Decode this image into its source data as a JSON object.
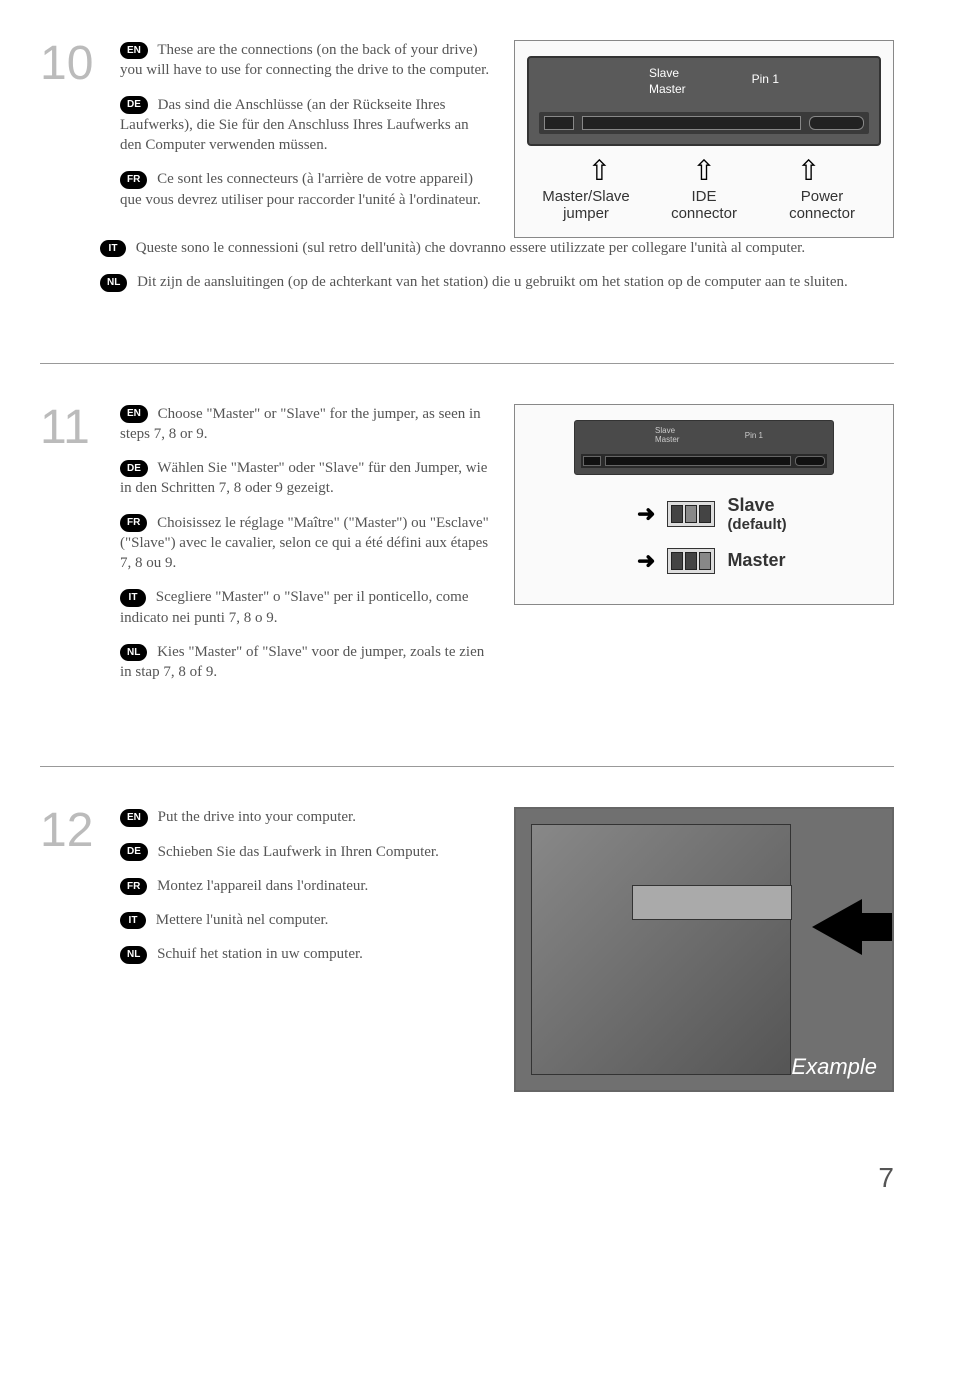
{
  "page_number": "7",
  "steps": {
    "s10": {
      "number": "10",
      "en": "These are the connections (on the back of your drive) you will have to use for connecting the drive to the computer.",
      "de": "Das sind die Anschlüsse (an der Rückseite Ihres Laufwerks), die Sie für den Anschluss Ihres Laufwerks an den Computer verwenden müssen.",
      "fr": "Ce sont les connecteurs (à l'arrière de votre appareil) que vous devrez utiliser pour raccorder l'unité à l'ordinateur.",
      "it": "Queste sono le connessioni (sul retro dell'unità) che dovranno essere utilizzate per collegare l'unità al computer.",
      "nl": "Dit zijn de aansluitingen (op de achterkant van het station) die u gebruikt om het station op de computer aan te sluiten."
    },
    "s11": {
      "number": "11",
      "en": "Choose \"Master\" or \"Slave\" for the jumper, as seen in steps 7, 8 or 9.",
      "de": "Wählen Sie \"Master\" oder \"Slave\" für den Jumper, wie in den Schritten 7, 8 oder 9 gezeigt.",
      "fr": "Choisissez le réglage \"Maître\" (\"Master\") ou \"Esclave\" (\"Slave\") avec le cavalier, selon ce qui a été défini aux étapes 7, 8 ou 9.",
      "it": "Scegliere \"Master\" o \"Slave\" per il ponticello, come indicato nei punti 7, 8 o 9.",
      "nl": "Kies \"Master\" of \"Slave\" voor de jumper, zoals te zien in stap 7, 8 of 9."
    },
    "s12": {
      "number": "12",
      "en": "Put the drive into your computer.",
      "de": "Schieben Sie das Laufwerk in Ihren Computer.",
      "fr": "Montez l'appareil dans l'ordinateur.",
      "it": "Mettere l'unità nel computer.",
      "nl": "Schuif het station in uw computer."
    }
  },
  "badges": {
    "en": "EN",
    "de": "DE",
    "fr": "FR",
    "it": "IT",
    "nl": "NL"
  },
  "diagram10": {
    "slave": "Slave",
    "master": "Master",
    "pin1": "Pin 1",
    "label1_line1": "Master/Slave",
    "label1_line2": "jumper",
    "label2_line1": "IDE",
    "label2_line2": "connector",
    "label3_line1": "Power",
    "label3_line2": "connector"
  },
  "diagram11": {
    "mini_slave": "Slave",
    "mini_master": "Master",
    "mini_pin": "Pin 1",
    "opt1_title": "Slave",
    "opt1_sub": "(default)",
    "opt2_title": "Master"
  },
  "diagram12": {
    "example": "Example"
  }
}
